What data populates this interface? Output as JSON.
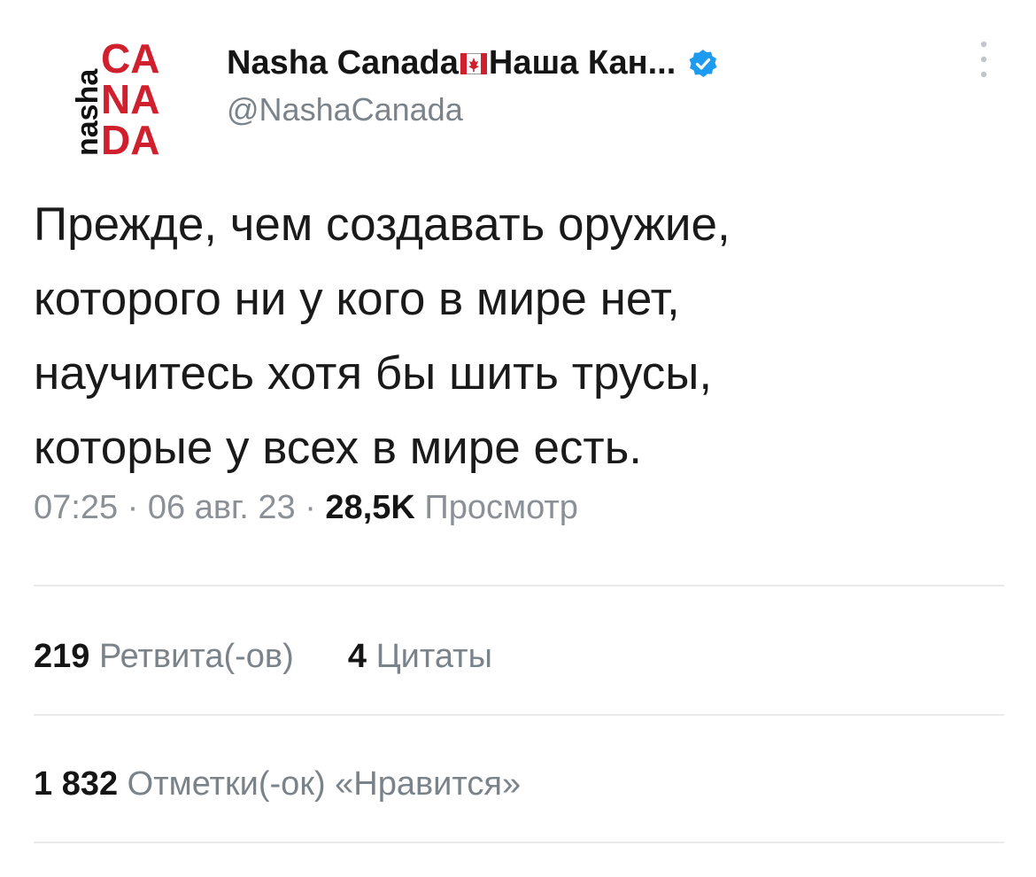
{
  "account": {
    "display_name_part1": "Nasha Canada",
    "display_name_part2": "Наша Кан...",
    "handle": "@NashaCanada",
    "logo": {
      "side_text": "nasha",
      "line1": "CA",
      "line2": "NA",
      "line3": "DA"
    },
    "flag_icon": "canada-flag-icon",
    "verified_icon": "verified-badge-icon"
  },
  "tweet": {
    "text": "Прежде, чем создавать оружие,\nкоторого ни у кого в мире нет,\nнаучитесь хотя бы шить трусы,\nкоторые у всех в мире есть.",
    "time": "07:25",
    "sep1": "·",
    "date": "06 авг. 23",
    "sep2": "·",
    "views_count": "28,5K",
    "views_label": "Просмотр"
  },
  "stats": {
    "retweets_count": "219",
    "retweets_label": "Ретвита(-ов)",
    "quotes_count": "4",
    "quotes_label": "Цитаты",
    "likes_count": "1 832",
    "likes_label": "Отметки(-ок) «Нравится»"
  },
  "colors": {
    "logo_red": "#d0202e",
    "logo_black": "#111111",
    "verified_blue": "#1d9bf0",
    "muted_text": "#7b838a",
    "divider": "#e8eaec"
  }
}
